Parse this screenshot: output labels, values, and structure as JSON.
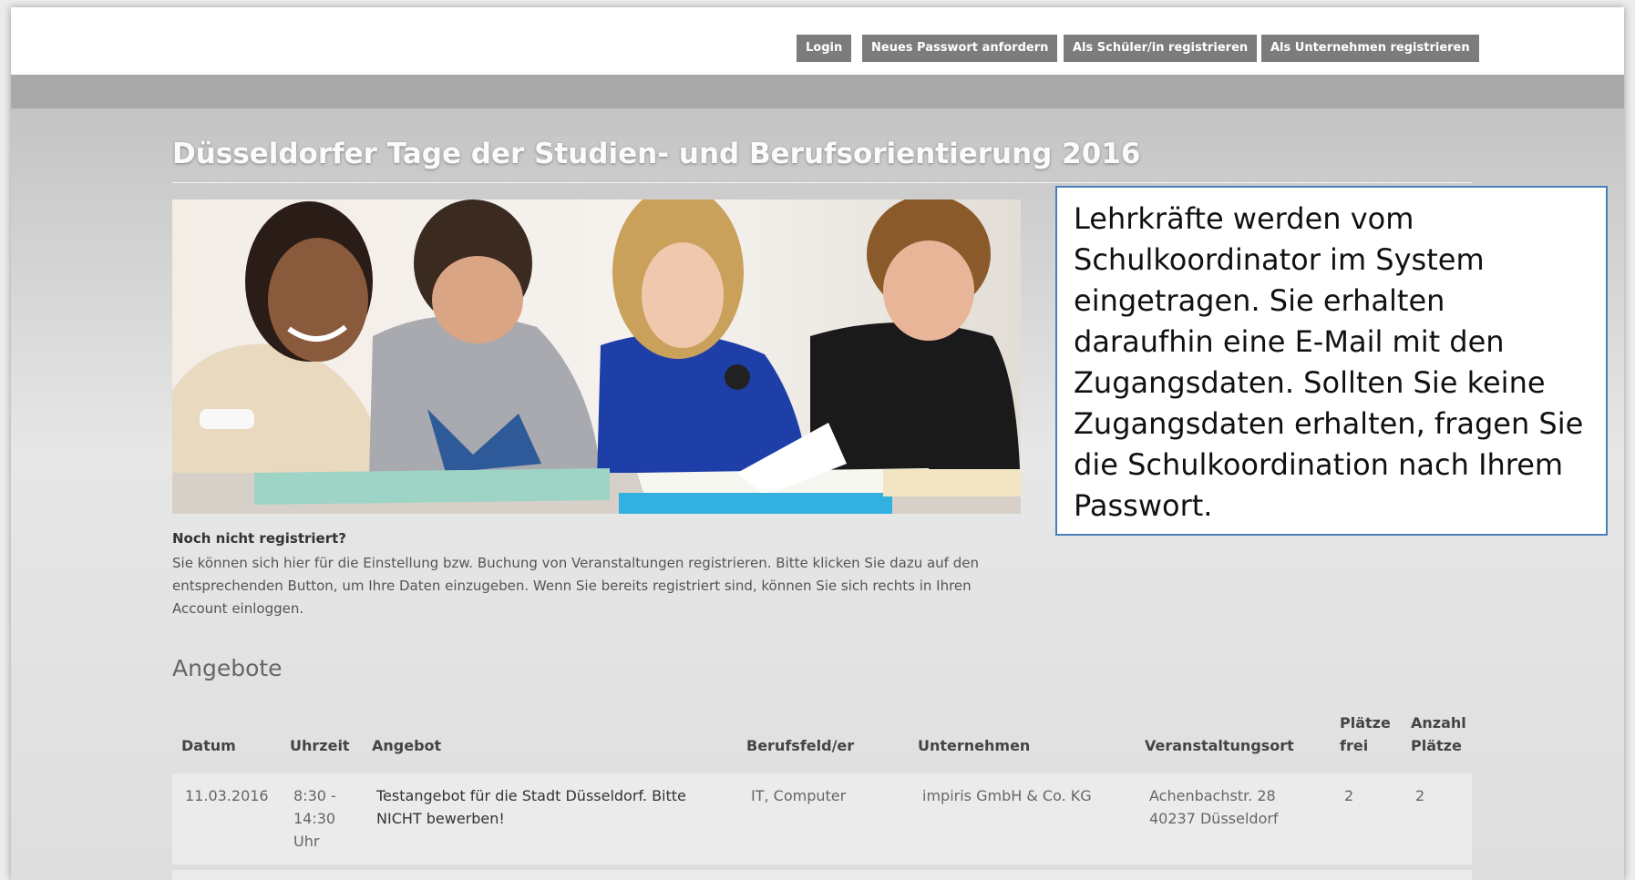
{
  "topnav": {
    "login": "Login",
    "password": "Neues Passwort anfordern",
    "register_student": "Als Schüler/in registrieren",
    "register_company": "Als Unternehmen registrieren"
  },
  "page": {
    "title": "Düsseldorfer Tage der Studien- und Berufsorientierung 2016"
  },
  "hero": {
    "description": "Foto: vier Jugendliche lesen gemeinsam Bücher am Tisch"
  },
  "registration": {
    "heading": "Noch nicht registriert?",
    "text": "Sie können sich hier für die Einstellung bzw. Buchung von Veranstaltungen registrieren. Bitte klicken Sie dazu auf den entsprechenden Button, um Ihre Daten einzugeben. Wenn Sie bereits registriert sind, können Sie sich rechts in Ihren Account einloggen."
  },
  "offers": {
    "title": "Angebote",
    "headers": {
      "datum": "Datum",
      "uhrzeit": "Uhrzeit",
      "angebot": "Angebot",
      "berufsfeld": "Berufsfeld/er",
      "unternehmen": "Unternehmen",
      "ort": "Veranstaltungsort",
      "plaetze_frei": "Plätze frei",
      "anzahl_plaetze": "Anzahl Plätze"
    },
    "rows": [
      {
        "datum": "11.03.2016",
        "uhrzeit": "8:30 - 14:30 Uhr",
        "angebot": "Testangebot für die Stadt Düsseldorf. Bitte NICHT bewerben!",
        "berufsfeld": "IT, Computer",
        "unternehmen": "impiris GmbH & Co. KG",
        "ort": "Achenbachstr. 28 40237 Düsseldorf",
        "frei": "2",
        "anzahl": "2"
      }
    ]
  },
  "callout": {
    "text": "Lehrkräfte werden vom Schulkoordinator im System eingetragen. Sie erhalten daraufhin eine E-Mail mit den Zugangsdaten. Sollten Sie keine Zugangsdaten erhalten, fragen Sie die Schulkoordination nach Ihrem Passwort."
  },
  "colors": {
    "nav_button": "#7c7c7c",
    "callout_border": "#4a7ebb",
    "row_background": "#ebebeb"
  }
}
